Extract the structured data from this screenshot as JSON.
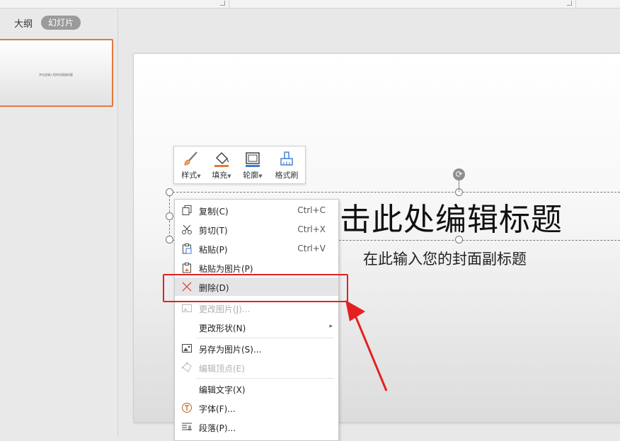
{
  "left_panel": {
    "tabs": [
      {
        "label": "大纲"
      },
      {
        "label": "幻灯片"
      }
    ],
    "thumbnail_text": "并在此输入您的封面副标题"
  },
  "slide": {
    "title": "击此处编辑标题",
    "subtitle": "在此输入您的封面副标题"
  },
  "mini_toolbar": {
    "items": [
      {
        "label": "样式",
        "icon": "brush-icon"
      },
      {
        "label": "填充",
        "icon": "fill-bucket-icon"
      },
      {
        "label": "轮廓",
        "icon": "outline-icon"
      },
      {
        "label": "格式刷",
        "icon": "format-painter-icon"
      }
    ]
  },
  "context_menu": {
    "items": [
      {
        "label": "复制(C)",
        "shortcut": "Ctrl+C",
        "icon": "copy-icon"
      },
      {
        "label": "剪切(T)",
        "shortcut": "Ctrl+X",
        "icon": "scissors-icon"
      },
      {
        "label": "粘贴(P)",
        "shortcut": "Ctrl+V",
        "icon": "paste-icon"
      },
      {
        "label": "粘贴为图片(P)",
        "icon": "paste-as-image-icon"
      },
      {
        "label": "删除(D)",
        "icon": "delete-x-icon",
        "highlighted": true
      },
      {
        "label": "更改图片(J)...",
        "icon": "change-image-icon",
        "disabled": true
      },
      {
        "label": "更改形状(N)",
        "has_submenu": true
      },
      {
        "label": "另存为图片(S)...",
        "icon": "save-image-icon"
      },
      {
        "label": "编辑顶点(E)",
        "icon": "edit-points-icon",
        "disabled": true
      },
      {
        "label": "编辑文字(X)"
      },
      {
        "label": "字体(F)...",
        "icon": "font-icon"
      },
      {
        "label": "段落(P)...",
        "icon": "paragraph-icon"
      }
    ]
  },
  "colors": {
    "accent_orange": "#e07a3c",
    "annotation_red": "#e32121",
    "delete_icon": "#d9534f"
  }
}
